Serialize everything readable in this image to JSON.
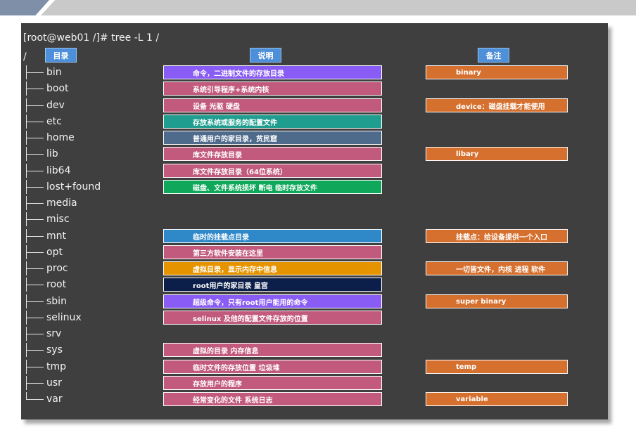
{
  "command": "[root@web01 /]# tree -L 1 /",
  "root_dir": "/",
  "headers": {
    "dir": "目录",
    "desc": "说明",
    "note": "备注"
  },
  "colors": {
    "purple": "#8a5cf6",
    "pink": "#c25a7e",
    "teal": "#1f9e8f",
    "slate": "#4f6b8c",
    "green": "#0fa85a",
    "blue": "#2f88c8",
    "amber": "#e59400",
    "navy": "#0b1f4a",
    "note": "#d6702f"
  },
  "rows": [
    {
      "dir": "bin",
      "desc": "命令，二进制文件的存放目录",
      "desc_color": "purple",
      "note": "binary"
    },
    {
      "dir": "boot",
      "desc": "系统引导程序+系统内核",
      "desc_color": "pink",
      "note": ""
    },
    {
      "dir": "dev",
      "desc": "设备 光驱 硬盘",
      "desc_color": "pink",
      "note": "device：磁盘挂载才能使用"
    },
    {
      "dir": "etc",
      "desc": "存放系统或服务的配置文件",
      "desc_color": "teal",
      "note": ""
    },
    {
      "dir": "home",
      "desc": "普通用户的家目录，贫民窟",
      "desc_color": "slate",
      "note": ""
    },
    {
      "dir": "lib",
      "desc": "库文件存放目录",
      "desc_color": "pink",
      "note": "libary"
    },
    {
      "dir": "lib64",
      "desc": "库文件存放目录（64位系统）",
      "desc_color": "pink",
      "note": ""
    },
    {
      "dir": "lost+found",
      "desc": "磁盘、文件系统损坏 断电 临时存放文件",
      "desc_color": "green",
      "note": ""
    },
    {
      "dir": "media",
      "desc": "",
      "desc_color": "",
      "note": ""
    },
    {
      "dir": "misc",
      "desc": "",
      "desc_color": "",
      "note": ""
    },
    {
      "dir": "mnt",
      "desc": "临时的挂载点目录",
      "desc_color": "blue",
      "note": "挂载点：给设备提供一个入口"
    },
    {
      "dir": "opt",
      "desc": "第三方软件安装在这里",
      "desc_color": "pink",
      "note": ""
    },
    {
      "dir": "proc",
      "desc": "虚拟目录，显示内存中信息",
      "desc_color": "amber",
      "note": "一切皆文件，内核 进程 软件"
    },
    {
      "dir": "root",
      "desc": "root用户的家目录 皇宫",
      "desc_color": "navy",
      "note": ""
    },
    {
      "dir": "sbin",
      "desc": "超级命令，只有root用户能用的命令",
      "desc_color": "purple",
      "note": "super  binary"
    },
    {
      "dir": "selinux",
      "desc": "selinux 及他的配置文件存放的位置",
      "desc_color": "pink",
      "note": ""
    },
    {
      "dir": "srv",
      "desc": "",
      "desc_color": "",
      "note": ""
    },
    {
      "dir": "sys",
      "desc": "虚拟的目录 内存信息",
      "desc_color": "pink",
      "note": ""
    },
    {
      "dir": "tmp",
      "desc": "临时文件的存放位置 垃圾堆",
      "desc_color": "pink",
      "note": "temp"
    },
    {
      "dir": "usr",
      "desc": "存放用户的程序",
      "desc_color": "pink",
      "note": ""
    },
    {
      "dir": "var",
      "desc": "经常变化的文件 系统日志",
      "desc_color": "pink",
      "note": "variable"
    }
  ]
}
